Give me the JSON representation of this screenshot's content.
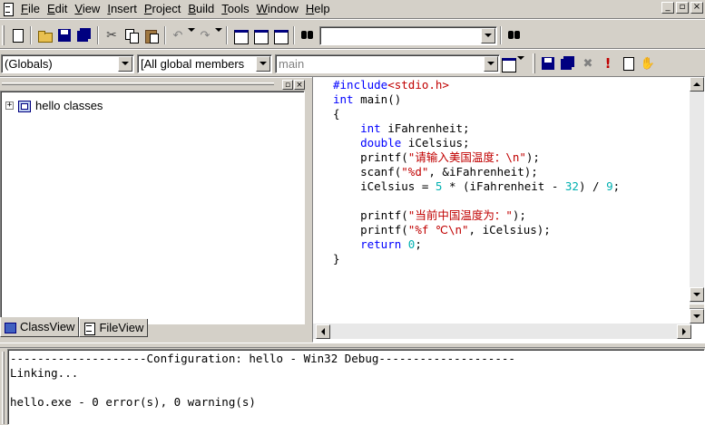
{
  "menubar": {
    "items": [
      {
        "key": "F",
        "rest": "ile"
      },
      {
        "key": "E",
        "rest": "dit"
      },
      {
        "key": "V",
        "rest": "iew"
      },
      {
        "key": "I",
        "rest": "nsert"
      },
      {
        "key": "P",
        "rest": "roject"
      },
      {
        "key": "B",
        "rest": "uild"
      },
      {
        "key": "T",
        "rest": "ools"
      },
      {
        "key": "W",
        "rest": "indow"
      },
      {
        "key": "H",
        "rest": "elp"
      }
    ],
    "mdi_minimize": "_",
    "mdi_restore": "▫",
    "mdi_close": "×"
  },
  "toolbar": {
    "find_combo_value": "",
    "cut_glyph": "✂",
    "undo_glyph": "↶",
    "redo_glyph": "↷"
  },
  "wizardbar": {
    "class_combo": "(Globals)",
    "filter_combo": "[All global members",
    "member_combo": "main",
    "exclaim_glyph": "!",
    "hand_glyph": "✋"
  },
  "workspace": {
    "btn_restore": "▫",
    "btn_close": "×",
    "tree_root_label": "hello classes",
    "tree_expander": "+",
    "tabs": [
      {
        "label": "ClassView",
        "active": true
      },
      {
        "label": "FileView",
        "active": false
      }
    ]
  },
  "editor": {
    "lines": [
      [
        {
          "t": "#include",
          "c": "kw"
        },
        {
          "t": "<stdio.h>",
          "c": "str"
        }
      ],
      [
        {
          "t": "int",
          "c": "kw"
        },
        {
          "t": " main()",
          "c": ""
        }
      ],
      [
        {
          "t": "{",
          "c": ""
        }
      ],
      [
        {
          "t": "    ",
          "c": ""
        },
        {
          "t": "int",
          "c": "kw"
        },
        {
          "t": " iFahrenheit;",
          "c": ""
        }
      ],
      [
        {
          "t": "    ",
          "c": ""
        },
        {
          "t": "double",
          "c": "kw"
        },
        {
          "t": " iCelsius;",
          "c": ""
        }
      ],
      [
        {
          "t": "    printf(",
          "c": ""
        },
        {
          "t": "\"请输入美国温度：\\n\"",
          "c": "str"
        },
        {
          "t": ");",
          "c": ""
        }
      ],
      [
        {
          "t": "    scanf(",
          "c": ""
        },
        {
          "t": "\"%d\"",
          "c": "str"
        },
        {
          "t": ", &iFahrenheit);",
          "c": ""
        }
      ],
      [
        {
          "t": "    iCelsius = ",
          "c": ""
        },
        {
          "t": "5",
          "c": "num"
        },
        {
          "t": " * (iFahrenheit - ",
          "c": ""
        },
        {
          "t": "32",
          "c": "num"
        },
        {
          "t": ") / ",
          "c": ""
        },
        {
          "t": "9",
          "c": "num"
        },
        {
          "t": ";",
          "c": ""
        }
      ],
      [
        {
          "t": "",
          "c": ""
        }
      ],
      [
        {
          "t": "    printf(",
          "c": ""
        },
        {
          "t": "\"当前中国温度为：\"",
          "c": "str"
        },
        {
          "t": ");",
          "c": ""
        }
      ],
      [
        {
          "t": "    printf(",
          "c": ""
        },
        {
          "t": "\"%f ℃\\n\"",
          "c": "str"
        },
        {
          "t": ", iCelsius);",
          "c": ""
        }
      ],
      [
        {
          "t": "    ",
          "c": ""
        },
        {
          "t": "return",
          "c": "kw"
        },
        {
          "t": " ",
          "c": ""
        },
        {
          "t": "0",
          "c": "num"
        },
        {
          "t": ";",
          "c": ""
        }
      ],
      [
        {
          "t": "}",
          "c": ""
        }
      ]
    ]
  },
  "output": {
    "lines": [
      "--------------------Configuration: hello - Win32 Debug--------------------",
      "Linking...",
      "",
      "hello.exe - 0 error(s), 0 warning(s)"
    ]
  },
  "colors": {
    "keyword": "#0000ff",
    "string": "#c00000",
    "number": "#00b0b0",
    "chrome": "#d4d0c8"
  }
}
